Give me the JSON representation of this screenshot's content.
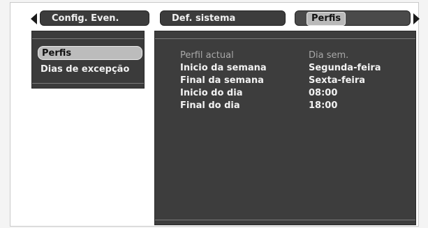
{
  "tabs": [
    {
      "label": "Config. Even."
    },
    {
      "label": "Def. sistema"
    },
    {
      "label": "Perfis"
    }
  ],
  "menu": {
    "items": [
      {
        "label": "Perfis"
      },
      {
        "label": "Dias de excepção"
      }
    ]
  },
  "details": {
    "rows": [
      {
        "key": "Perfil actual",
        "value": "Dia sem."
      },
      {
        "key": "Inicio da semana",
        "value": "Segunda-feira"
      },
      {
        "key": "Final da semana",
        "value": "Sexta-feira"
      },
      {
        "key": "Inicio do dia",
        "value": "08:00"
      },
      {
        "key": "Final do dia",
        "value": "18:00"
      }
    ]
  },
  "icons": {
    "left": "chevron-left-icon",
    "right": "chevron-right-icon"
  }
}
